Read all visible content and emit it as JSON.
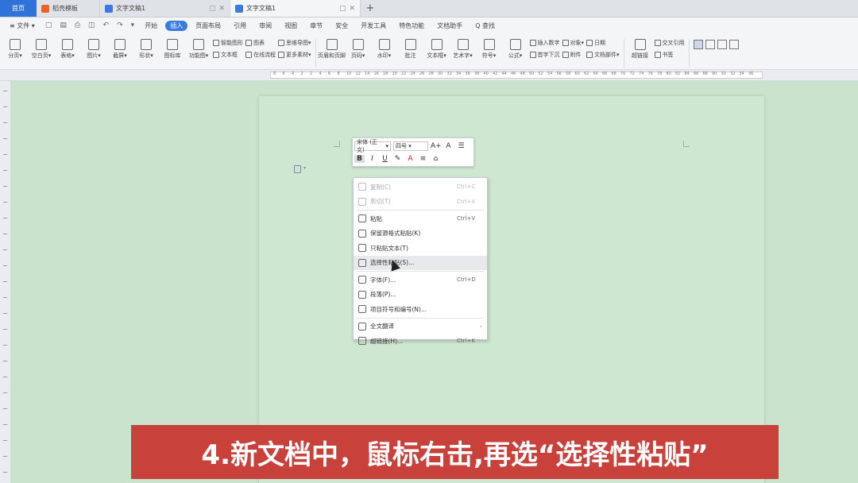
{
  "tabs": {
    "home": "首页",
    "tab1": "稻壳模板",
    "tab2": "文字文稿1",
    "tab3": "文字文稿1",
    "add": "+"
  },
  "menu": {
    "file": "≡ 文件 ▾",
    "items": [
      "开始",
      "插入",
      "页面布局",
      "引用",
      "审阅",
      "视图",
      "章节",
      "安全",
      "开发工具",
      "特色功能",
      "文档助手",
      "Q 查找"
    ],
    "active_index": 1
  },
  "ribbon": {
    "big": [
      "分页▾",
      "空白页▾",
      "表格▾",
      "图片▾",
      "截屏▾",
      "形状▾",
      "图标库",
      "功能图▾"
    ],
    "col1": [
      "智能图形",
      "文本框"
    ],
    "col2": [
      "图表",
      "在线流程"
    ],
    "col3": [
      "思维导图▾",
      "更多素材▾"
    ],
    "big2": [
      "页眉和页脚",
      "页码▾",
      "水印▾",
      "批注",
      "文本框▾",
      "艺术字▾",
      "符号▾",
      "公式▾"
    ],
    "col4": [
      "插入数字",
      "首字下沉"
    ],
    "col5": [
      "对象▾",
      "附件"
    ],
    "col6": [
      "日期",
      "文档部件▾"
    ],
    "big3": [
      "超链接"
    ],
    "col7": [
      "交叉引用",
      "书签"
    ]
  },
  "ruler_numbers": [
    "8",
    "6",
    "4",
    "2",
    "2",
    "4",
    "6",
    "8",
    "10",
    "12",
    "14",
    "16",
    "18",
    "20",
    "22",
    "24",
    "26",
    "28",
    "30",
    "32",
    "34",
    "36",
    "38",
    "40",
    "42",
    "44",
    "46",
    "48",
    "50",
    "52",
    "54",
    "56",
    "58",
    "60",
    "62",
    "64",
    "66",
    "68",
    "70",
    "72",
    "74",
    "76",
    "78",
    "80",
    "82",
    "84",
    "86",
    "88",
    "90",
    "30",
    "32",
    "34",
    "36"
  ],
  "minibar": {
    "font": "宋体 (正文)",
    "size": "四号",
    "grow": "A+",
    "shrink": "A",
    "bold": "B",
    "italic": "I",
    "underline": "U",
    "color": "A"
  },
  "context_menu": [
    {
      "label": "复制(C)",
      "shortcut": "Ctrl+C",
      "disabled": true
    },
    {
      "label": "剪切(T)",
      "shortcut": "Ctrl+X",
      "disabled": true
    },
    {
      "label": "粘贴",
      "shortcut": "Ctrl+V",
      "disabled": false
    },
    {
      "label": "保留源格式粘贴(K)",
      "shortcut": "",
      "disabled": false
    },
    {
      "label": "只粘贴文本(T)",
      "shortcut": "",
      "disabled": false
    },
    {
      "label": "选择性粘贴(S)...",
      "shortcut": "",
      "disabled": false,
      "highlighted": true
    },
    {
      "label": "字体(F)...",
      "shortcut": "Ctrl+D",
      "disabled": false
    },
    {
      "label": "段落(P)...",
      "shortcut": "",
      "disabled": false
    },
    {
      "label": "项目符号和编号(N)...",
      "shortcut": "",
      "disabled": false
    },
    {
      "label": "全文翻译",
      "shortcut": "",
      "disabled": false,
      "submenu": true
    },
    {
      "label": "超链接(H)...",
      "shortcut": "Ctrl+K",
      "disabled": false
    }
  ],
  "caption": "4.新文档中，鼠标右击,再选“选择性粘贴”",
  "colors": {
    "accent": "#3b7be0",
    "page_bg": "#cde7d1",
    "caption_bg": "#c9413b"
  }
}
